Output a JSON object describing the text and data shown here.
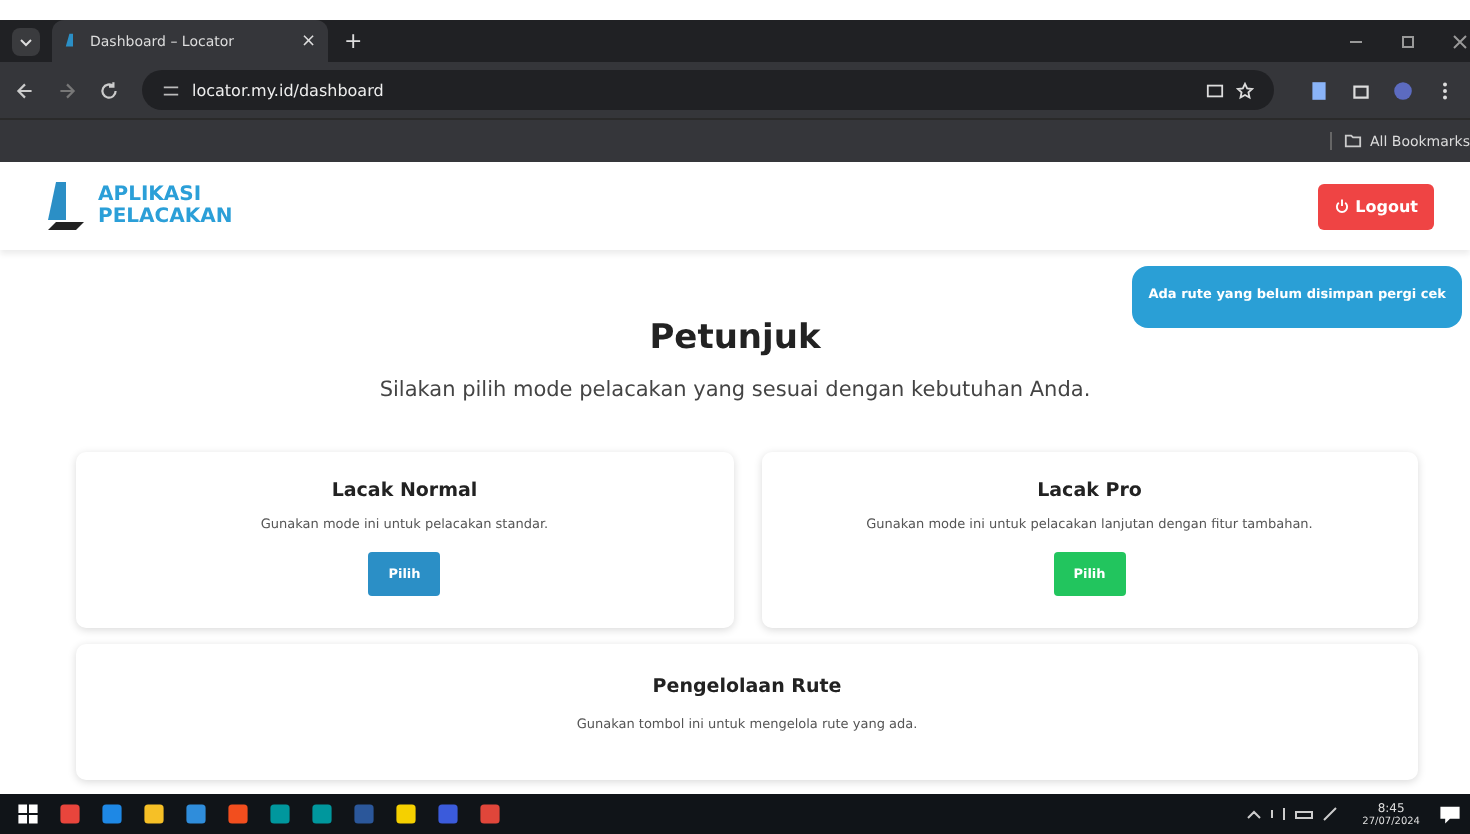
{
  "browser": {
    "tab_title": "Dashboard – Locator",
    "tab_close": "×",
    "new_tab": "+",
    "url": "locator.my.id/dashboard",
    "bookmarks_label": "All Bookmarks"
  },
  "header": {
    "logo_line1": "APLIKASI",
    "logo_line2": "PELACAKAN",
    "logout": "Logout"
  },
  "toast": "Ada rute yang belum disimpan pergi cek",
  "heading": "Petunjuk",
  "subtitle": "Silakan pilih mode pelacakan yang sesuai dengan kebutuhan Anda.",
  "cards": [
    {
      "title": "Lacak Normal",
      "text": "Gunakan mode ini untuk pelacakan standar.",
      "button": "Pilih",
      "color": "#2b8fc6"
    },
    {
      "title": "Lacak Pro",
      "text": "Gunakan mode ini untuk pelacakan lanjutan dengan fitur tambahan.",
      "button": "Pilih",
      "color": "#22c55e"
    }
  ],
  "route_card": {
    "title": "Pengelolaan Rute",
    "text": "Gunakan tombol ini untuk mengelola rute yang ada."
  },
  "taskbar": {
    "apps": [
      {
        "color": "#e8453c"
      },
      {
        "color": "#1e88e5"
      },
      {
        "color": "#f6c026"
      },
      {
        "color": "#2f8ddb"
      },
      {
        "color": "#f24e1e"
      },
      {
        "color": "#00979d"
      },
      {
        "color": "#00979d"
      },
      {
        "color": "#2b579a"
      },
      {
        "color": "#f5d000"
      },
      {
        "color": "#3b5bdb"
      },
      {
        "color": "#e0463a"
      }
    ],
    "time": "8:45",
    "date": "27/07/2024"
  }
}
